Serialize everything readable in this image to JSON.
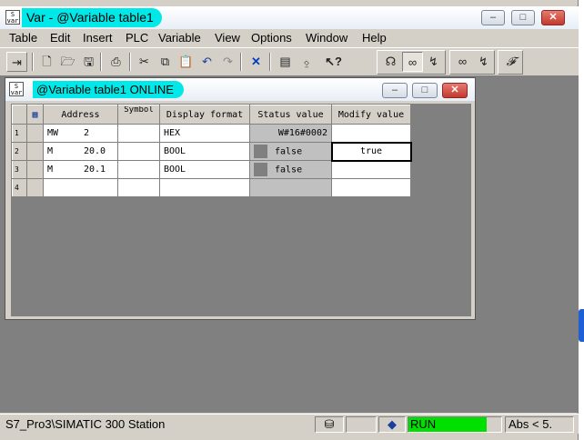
{
  "window": {
    "title": "Var - @Variable table1",
    "controls": {
      "minimize": "–",
      "maximize": "□",
      "close": "✕"
    }
  },
  "menu": [
    "Table",
    "Edit",
    "Insert",
    "PLC",
    "Variable",
    "View",
    "Options",
    "Window",
    "Help"
  ],
  "toolbar": {
    "icons": [
      "pin-icon",
      "new-icon",
      "open-icon",
      "save-icon",
      "print-icon",
      "cut-icon",
      "copy-icon",
      "paste-icon",
      "undo-icon",
      "redo-icon",
      "delete-icon",
      "monitor-icon",
      "variable-icon",
      "help-icon",
      "connect-icon",
      "glasses-icon",
      "modify-icon",
      "monitor-variable-icon",
      "modify-variable-icon",
      "force-icon"
    ]
  },
  "child_window": {
    "title": "@Variable table1  ONLINE",
    "controls": {
      "minimize": "–",
      "maximize": "□",
      "close": "✕"
    }
  },
  "table": {
    "columns": [
      "",
      "",
      "Address",
      "Symbol",
      "Display format",
      "Status value",
      "Modify value"
    ],
    "rows": [
      {
        "num": "1",
        "addr_type": "MW",
        "addr_num": "2",
        "symbol": "",
        "format": "HEX",
        "status": "W#16#0002",
        "modify": "",
        "status_square": false
      },
      {
        "num": "2",
        "addr_type": "M",
        "addr_num": "20.0",
        "symbol": "",
        "format": "BOOL",
        "status": "false",
        "modify": "true",
        "status_square": true
      },
      {
        "num": "3",
        "addr_type": "M",
        "addr_num": "20.1",
        "symbol": "",
        "format": "BOOL",
        "status": "false",
        "modify": "",
        "status_square": true
      },
      {
        "num": "4",
        "addr_type": "",
        "addr_num": "",
        "symbol": "",
        "format": "",
        "status": "",
        "modify": "",
        "status_square": false
      }
    ]
  },
  "statusbar": {
    "path": "S7_Pro3\\SIMATIC 300 Station",
    "mode": "RUN",
    "abs": "Abs < 5.",
    "run_color": "#00e000"
  }
}
